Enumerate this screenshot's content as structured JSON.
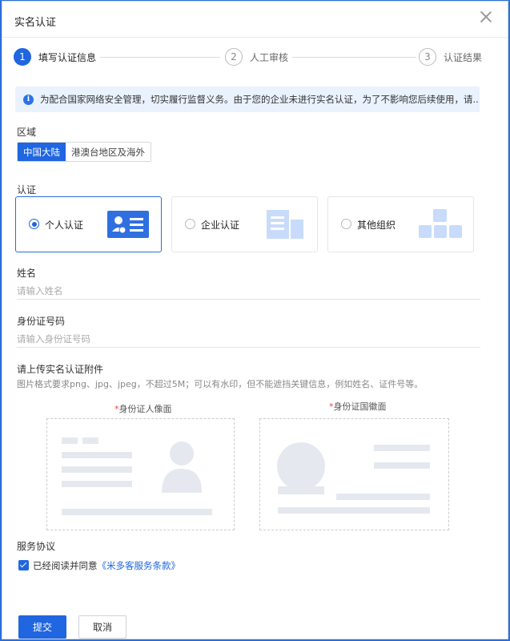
{
  "dialog": {
    "title": "实名认证"
  },
  "steps": [
    {
      "num": "1",
      "label": "填写认证信息"
    },
    {
      "num": "2",
      "label": "人工审核"
    },
    {
      "num": "3",
      "label": "认证结果"
    }
  ],
  "notice": "为配合国家网络安全管理，切实履行监督义务。由于您的企业未进行实名认证，为了不影响您后续使用，请...",
  "region": {
    "label": "区域",
    "options": [
      "中国大陆",
      "港澳台地区及海外"
    ]
  },
  "auth": {
    "label": "认证",
    "options": [
      "个人认证",
      "企业认证",
      "其他组织"
    ]
  },
  "name": {
    "label": "姓名",
    "placeholder": "请输入姓名"
  },
  "idnum": {
    "label": "身份证号码",
    "placeholder": "请输入身份证号码"
  },
  "upload": {
    "label": "请上传实名认证附件",
    "hint": "图片格式要求png、jpg、jpeg，不超过5M；可以有水印，但不能遮挡关键信息，例如姓名、证件号等。",
    "front": "身份证人像面",
    "back": "身份证国徽面",
    "required_mark": "*"
  },
  "agreement": {
    "label": "服务协议",
    "text": "已经阅读并同意",
    "link": "《米多客服务条款》"
  },
  "buttons": {
    "submit": "提交",
    "cancel": "取消"
  }
}
